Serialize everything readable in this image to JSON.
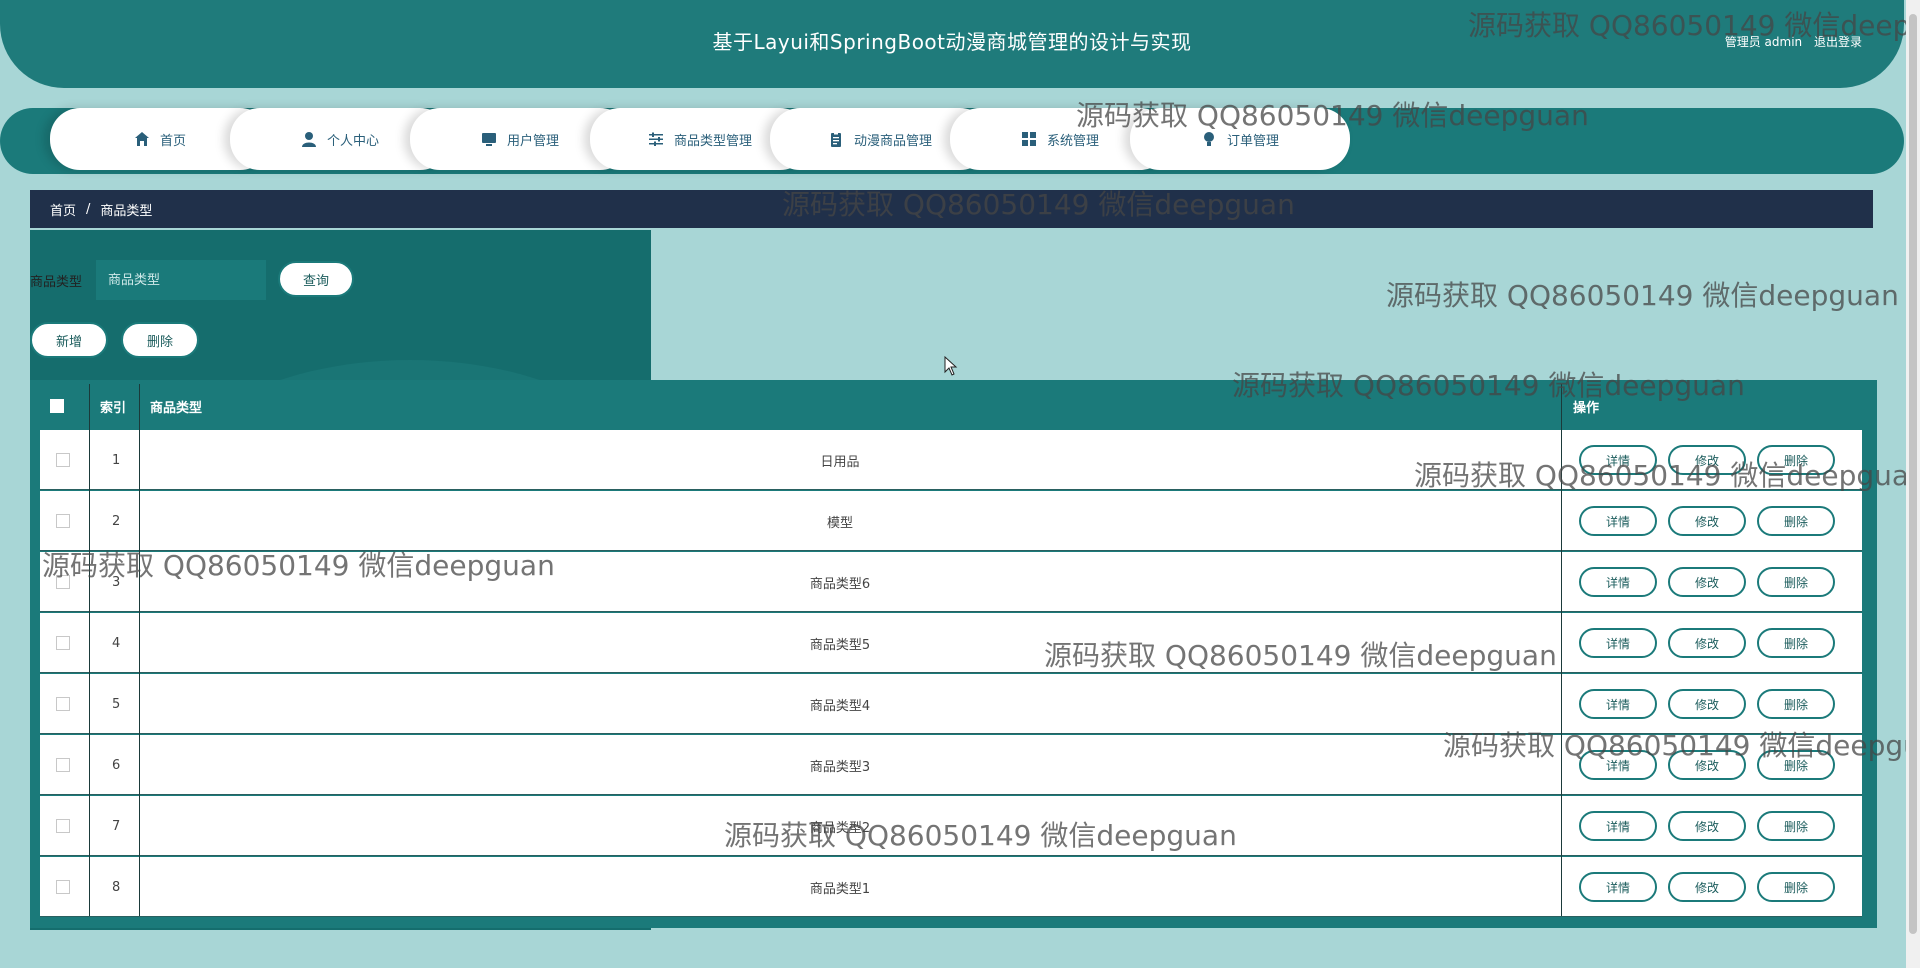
{
  "header": {
    "title": "基于Layui和SpringBoot动漫商城管理的设计与实现",
    "user_label": "管理员 admin",
    "logout": "退出登录"
  },
  "nav": [
    {
      "label": "首页",
      "icon": "home-icon"
    },
    {
      "label": "个人中心",
      "icon": "user-icon"
    },
    {
      "label": "用户管理",
      "icon": "monitor-icon"
    },
    {
      "label": "商品类型管理",
      "icon": "sliders-icon"
    },
    {
      "label": "动漫商品管理",
      "icon": "clipboard-icon"
    },
    {
      "label": "系统管理",
      "icon": "grid-icon"
    },
    {
      "label": "订单管理",
      "icon": "lightbulb-icon"
    }
  ],
  "breadcrumb": {
    "home": "首页",
    "sep": "/",
    "current": "商品类型"
  },
  "search": {
    "label": "商品类型",
    "placeholder": "商品类型",
    "query_button": "查询"
  },
  "toolbar": {
    "add": "新增",
    "delete": "删除"
  },
  "table": {
    "headers": {
      "index": "索引",
      "type": "商品类型",
      "actions": "操作"
    },
    "rows": [
      {
        "index": "1",
        "type": "日用品"
      },
      {
        "index": "2",
        "type": "模型"
      },
      {
        "index": "3",
        "type": "商品类型6"
      },
      {
        "index": "4",
        "type": "商品类型5"
      },
      {
        "index": "5",
        "type": "商品类型4"
      },
      {
        "index": "6",
        "type": "商品类型3"
      },
      {
        "index": "7",
        "type": "商品类型2"
      },
      {
        "index": "8",
        "type": "商品类型1"
      }
    ],
    "row_actions": {
      "detail": "详情",
      "edit": "修改",
      "delete": "删除"
    }
  },
  "watermark": "源码获取 QQ86050149 微信deepguan",
  "colors": {
    "primary": "#1b7a7a",
    "breadcrumb_bg": "#20304a",
    "page_bg": "#a8d6d6"
  }
}
